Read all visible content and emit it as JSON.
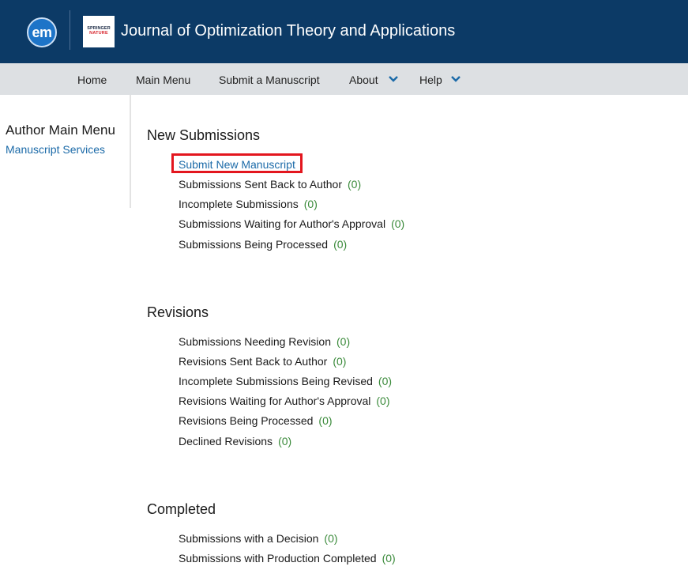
{
  "header": {
    "em_logo": "em",
    "publisher_logo_line1": "SPRINGER",
    "publisher_logo_line2": "NATURE",
    "journal_title": "Journal of Optimization Theory and Applications"
  },
  "nav": {
    "home": "Home",
    "main_menu": "Main Menu",
    "submit": "Submit a Manuscript",
    "about": "About",
    "help": "Help"
  },
  "sidebar": {
    "title": "Author Main Menu",
    "link": "Manuscript Services"
  },
  "sections": {
    "new": {
      "title": "New Submissions",
      "items": [
        {
          "label": "Submit New Manuscript"
        },
        {
          "label": "Submissions Sent Back to Author",
          "count": "(0)"
        },
        {
          "label": "Incomplete Submissions",
          "count": "(0)"
        },
        {
          "label": "Submissions Waiting for Author's Approval",
          "count": "(0)"
        },
        {
          "label": "Submissions Being Processed",
          "count": "(0)"
        }
      ]
    },
    "revisions": {
      "title": "Revisions",
      "items": [
        {
          "label": "Submissions Needing Revision",
          "count": "(0)"
        },
        {
          "label": "Revisions Sent Back to Author",
          "count": "(0)"
        },
        {
          "label": "Incomplete Submissions Being Revised",
          "count": "(0)"
        },
        {
          "label": "Revisions Waiting for Author's Approval",
          "count": "(0)"
        },
        {
          "label": "Revisions Being Processed",
          "count": "(0)"
        },
        {
          "label": "Declined Revisions",
          "count": "(0)"
        }
      ]
    },
    "completed": {
      "title": "Completed",
      "items": [
        {
          "label": "Submissions with a Decision",
          "count": "(0)"
        },
        {
          "label": "Submissions with Production Completed",
          "count": "(0)"
        }
      ]
    }
  },
  "colors": {
    "header_bg": "#0c3a66",
    "nav_bg": "#dde0e3",
    "link": "#1b6aa8",
    "count": "#3a8a3a",
    "highlight": "#e3161e"
  }
}
